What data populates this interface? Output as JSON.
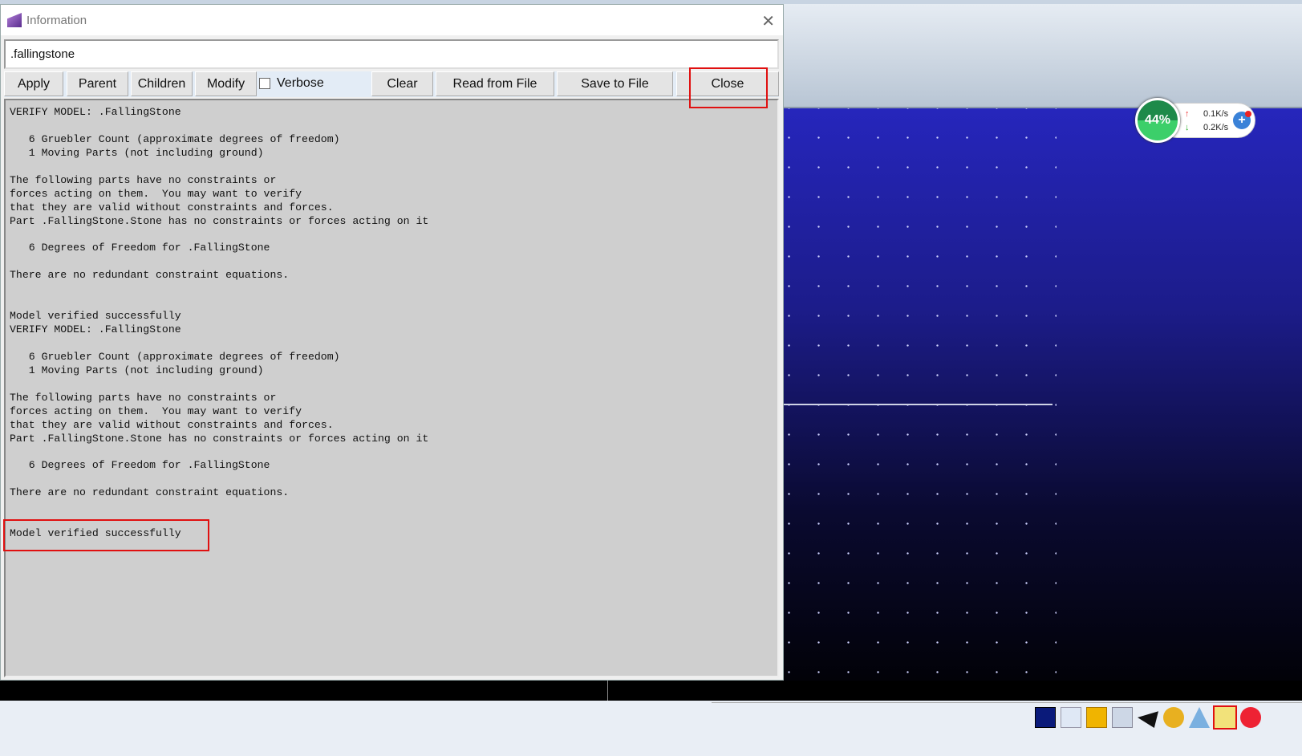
{
  "dialog": {
    "title": "Information",
    "object_field": ".fallingstone",
    "buttons": {
      "apply": "Apply",
      "parent": "Parent",
      "children": "Children",
      "modify": "Modify",
      "clear": "Clear",
      "read": "Read from File",
      "save": "Save to File",
      "close": "Close"
    },
    "verbose_label": "Verbose",
    "verbose_checked": false,
    "output_lines": [
      "VERIFY MODEL: .FallingStone",
      "",
      "   6 Gruebler Count (approximate degrees of freedom)",
      "   1 Moving Parts (not including ground)",
      "",
      "The following parts have no constraints or",
      "forces acting on them.  You may want to verify",
      "that they are valid without constraints and forces.",
      "Part .FallingStone.Stone has no constraints or forces acting on it",
      "",
      "   6 Degrees of Freedom for .FallingStone",
      "",
      "There are no redundant constraint equations.",
      "",
      "",
      "Model verified successfully",
      "VERIFY MODEL: .FallingStone",
      "",
      "   6 Gruebler Count (approximate degrees of freedom)",
      "   1 Moving Parts (not including ground)",
      "",
      "The following parts have no constraints or",
      "forces acting on them.  You may want to verify",
      "that they are valid without constraints and forces.",
      "Part .FallingStone.Stone has no constraints or forces acting on it",
      "",
      "   6 Degrees of Freedom for .FallingStone",
      "",
      "There are no redundant constraint equations.",
      "",
      "",
      "Model verified successfully"
    ]
  },
  "net_widget": {
    "percent": "44%",
    "upload": "0.1K/s",
    "download": "0.2K/s",
    "fill_percent": 44
  },
  "highlight_color": "#e01010",
  "tray_icons": [
    "window-icon",
    "axis-icon",
    "folder-icon",
    "grid-icon",
    "hat-icon",
    "globe-icon",
    "network-icon",
    "file-check-icon",
    "stop-icon"
  ]
}
